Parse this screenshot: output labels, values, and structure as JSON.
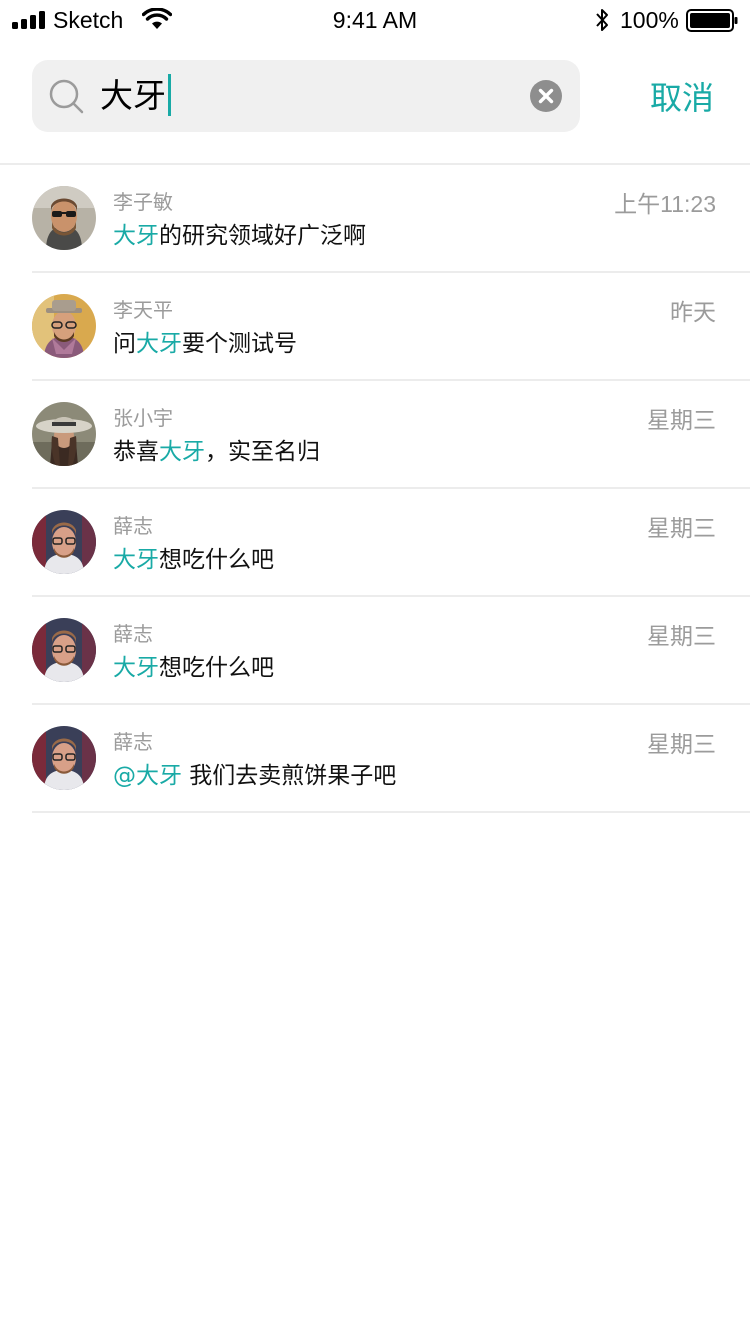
{
  "status_bar": {
    "carrier": "Sketch",
    "time": "9:41 AM",
    "battery": "100%"
  },
  "search": {
    "query": "大牙",
    "cancel_label": "取消"
  },
  "results": [
    {
      "sender": "李子敏",
      "time": "上午11:23",
      "pre": "",
      "highlight": "大牙",
      "post": "的研究领域好广泛啊",
      "avatar": "avatar-man-sunglasses"
    },
    {
      "sender": "李天平",
      "time": "昨天",
      "pre": "问",
      "highlight": "大牙",
      "post": "要个测试号",
      "avatar": "avatar-man-hat-scarf"
    },
    {
      "sender": "张小宇",
      "time": "星期三",
      "pre": "恭喜",
      "highlight": "大牙",
      "post": "，实至名归",
      "avatar": "avatar-woman-hat"
    },
    {
      "sender": "薛志",
      "time": "星期三",
      "pre": "",
      "highlight": "大牙",
      "post": "想吃什么吧",
      "avatar": "avatar-man-glasses"
    },
    {
      "sender": "薛志",
      "time": "星期三",
      "pre": "",
      "highlight": "大牙",
      "post": "想吃什么吧",
      "avatar": "avatar-man-glasses"
    },
    {
      "sender": "薛志",
      "time": "星期三",
      "pre": "",
      "highlight": "@大牙",
      "post": " 我们去卖煎饼果子吧",
      "avatar": "avatar-man-glasses"
    }
  ],
  "colors": {
    "accent": "#19aaa6",
    "secondary_text": "#9b9b9b",
    "search_bg": "#f0f0f0"
  }
}
